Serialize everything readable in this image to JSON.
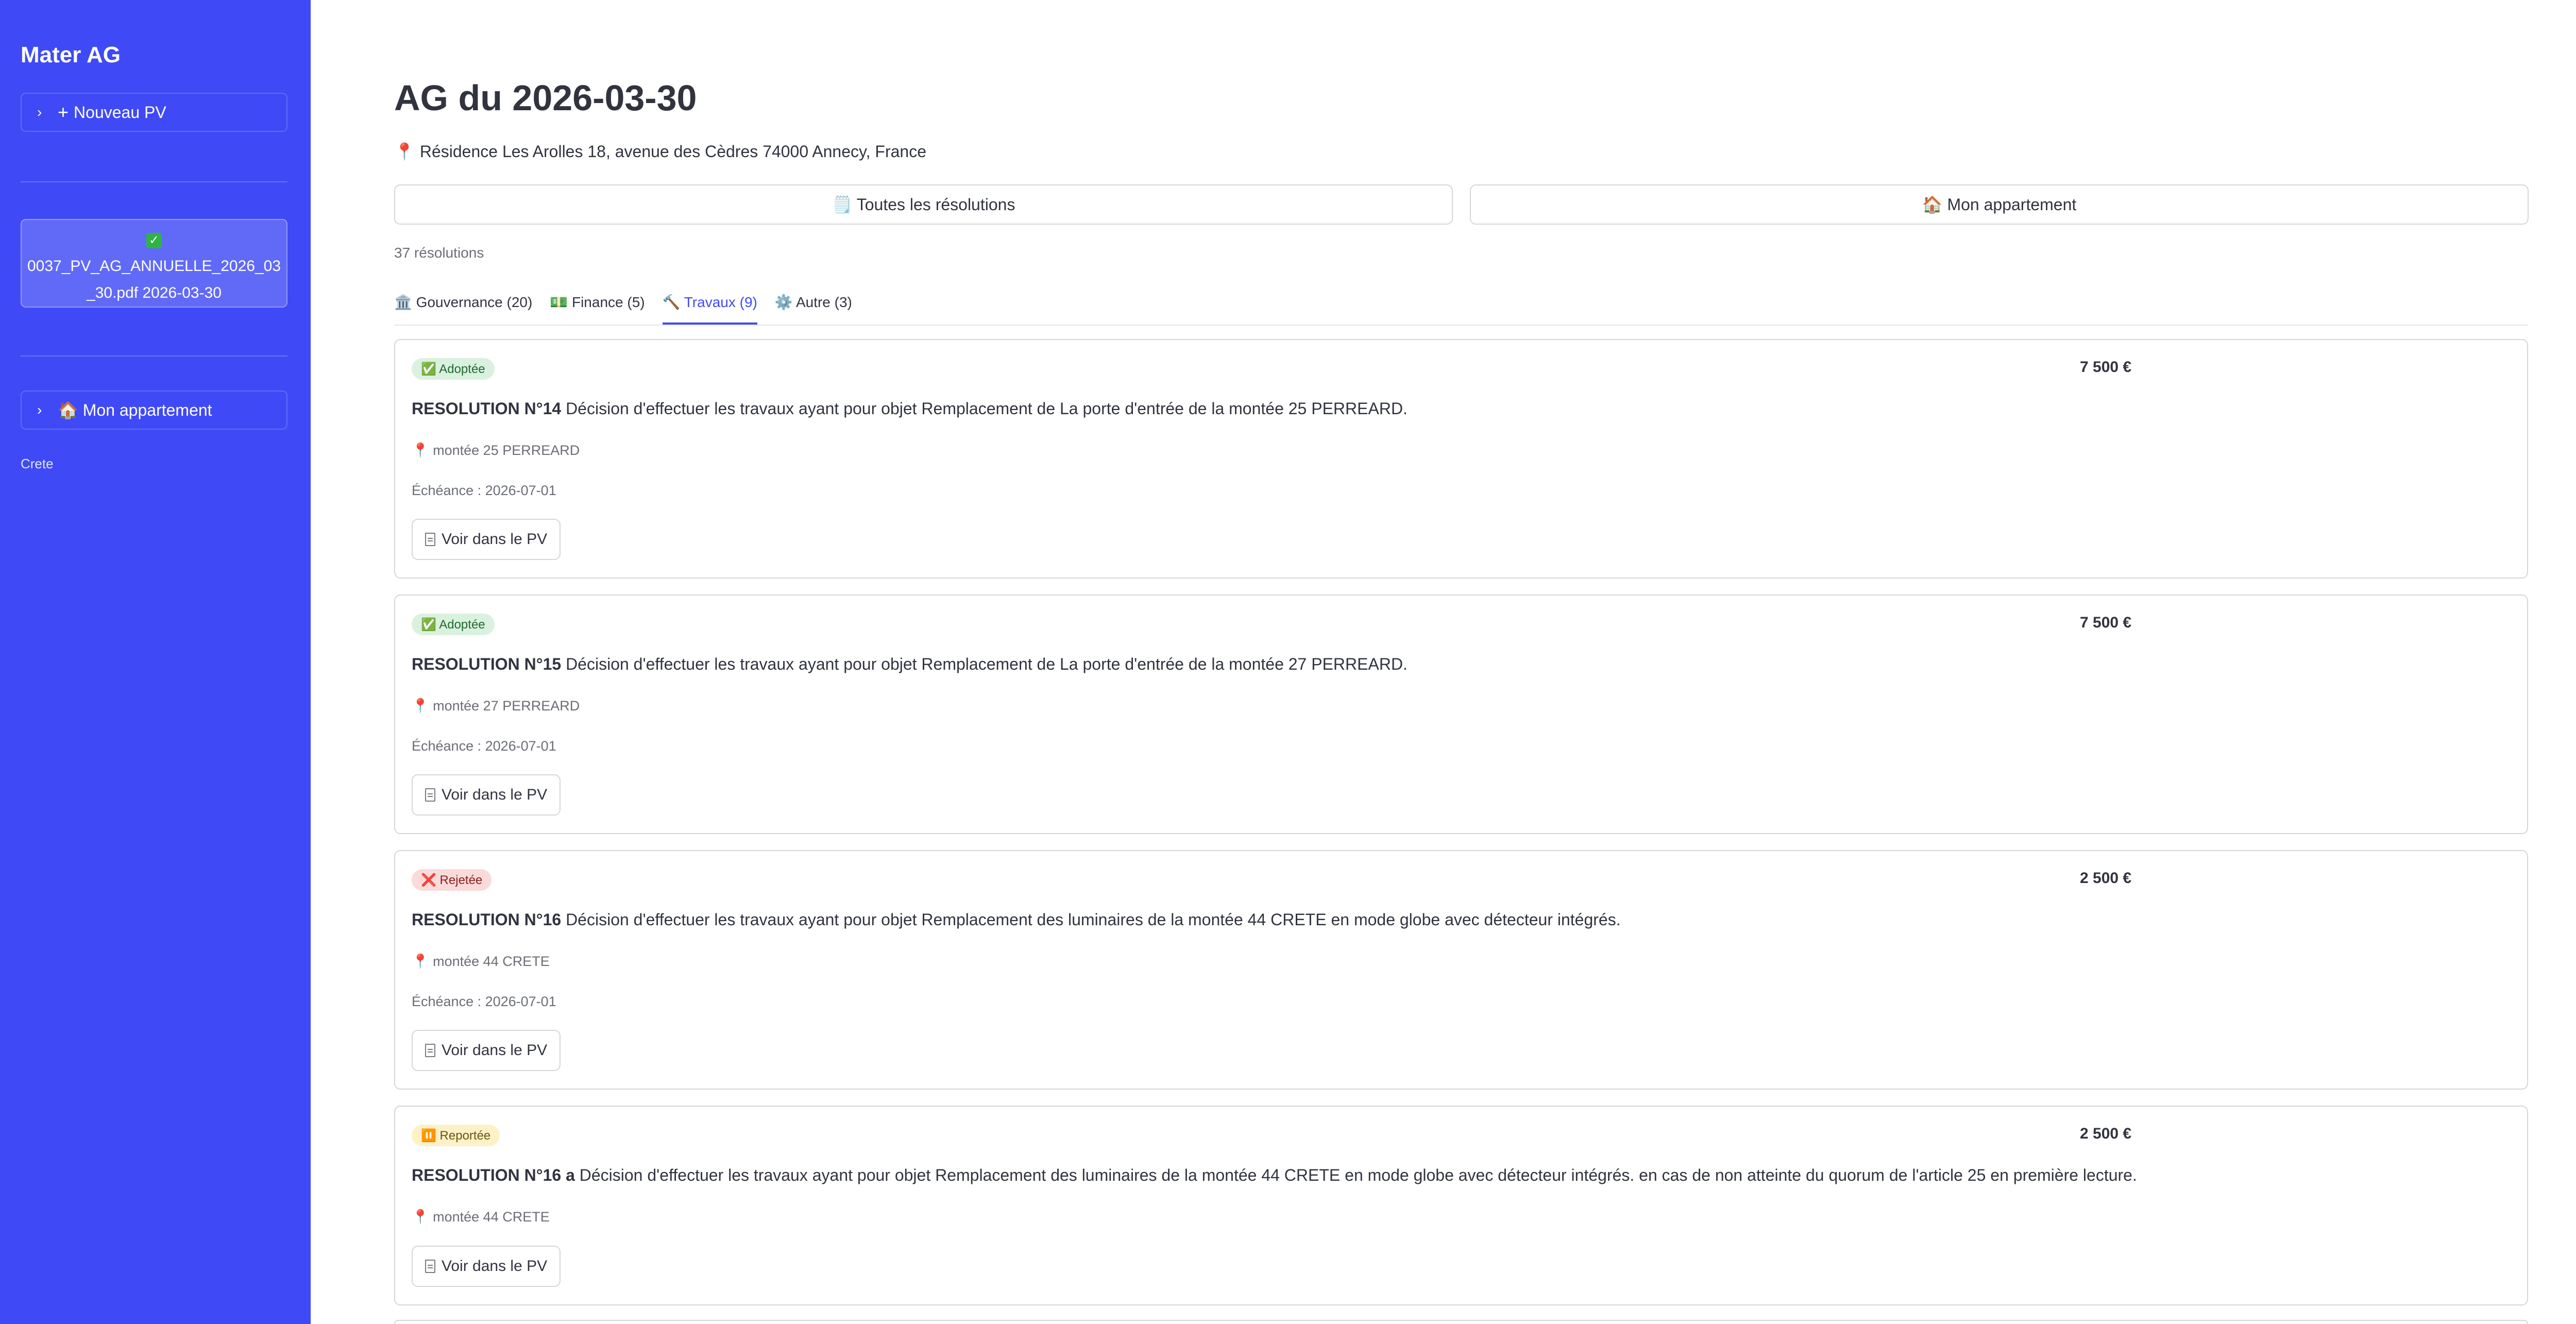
{
  "sidebar": {
    "app_title": "Mater AG",
    "new_pv_label": "Nouveau PV",
    "file": {
      "status_icon": "✅",
      "filename_line1": "0037_PV_AG_ANNUELLE_2026_03",
      "filename_line2": "_30.pdf 2026-03-30"
    },
    "my_apartment_label": "🏠 Mon appartement",
    "note": "Crete"
  },
  "main": {
    "title": "AG du 2026-03-30",
    "address_icon": "📍",
    "address": "Résidence Les Arolles 18, avenue des Cèdres 74000 Annecy, France",
    "view_buttons": [
      "🗒️ Toutes les résolutions",
      "🏠 Mon appartement"
    ],
    "count": "37 résolutions",
    "tabs": [
      {
        "label": "🏛️ Gouvernance (20)",
        "active": false
      },
      {
        "label": "💵 Finance (5)",
        "active": false
      },
      {
        "label": "🔨 Travaux (9)",
        "active": true
      },
      {
        "label": "⚙️ Autre (3)",
        "active": false
      }
    ],
    "resolutions": [
      {
        "status": "✅ Adoptée",
        "status_color": "#dbf1df",
        "amount": "7 500 €",
        "number": "RESOLUTION N°14",
        "text": "Décision d'effectuer les travaux ayant pour objet Remplacement de La porte d'entrée de la montée 25 PERREARD.",
        "location": "📍 montée 25 PERREARD",
        "deadline": "Échéance : 2026-07-01",
        "button": "Voir dans le PV"
      },
      {
        "status": "✅ Adoptée",
        "status_color": "#dbf1df",
        "amount": "7 500 €",
        "number": "RESOLUTION N°15",
        "text": "Décision d'effectuer les travaux ayant pour objet Remplacement de La porte d'entrée de la montée 27 PERREARD.",
        "location": "📍 montée 27 PERREARD",
        "deadline": "Échéance : 2026-07-01",
        "button": "Voir dans le PV"
      },
      {
        "status": "❌ Rejetée",
        "status_color": "#fbdada",
        "amount": "2 500 €",
        "number": "RESOLUTION N°16",
        "text": "Décision d'effectuer les travaux ayant pour objet Remplacement des luminaires de la montée 44 CRETE en mode globe avec détecteur intégrés.",
        "location": "📍 montée 44 CRETE",
        "deadline": "Échéance : 2026-07-01",
        "button": "Voir dans le PV"
      },
      {
        "status": "⏸️ Reportée",
        "status_color": "#fdf1c7",
        "amount": "2 500 €",
        "number": "RESOLUTION N°16 a",
        "text": "Décision d'effectuer les travaux ayant pour objet Remplacement des luminaires de la montée 44 CRETE en mode globe avec détecteur intégrés. en cas de non atteinte du quorum de l'article 25 en première lecture.",
        "location": "📍 montée 44 CRETE",
        "button": "Voir dans le PV"
      }
    ]
  }
}
